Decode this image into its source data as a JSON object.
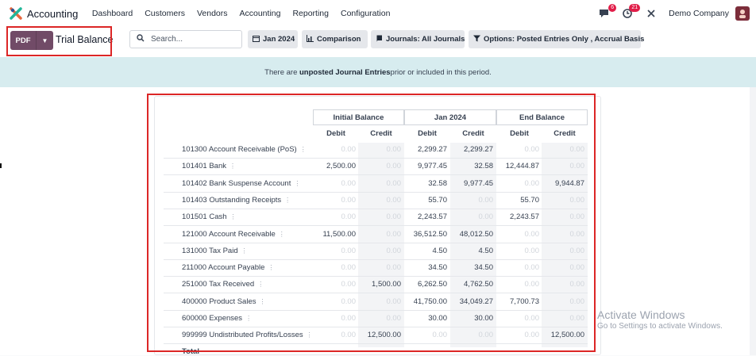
{
  "topbar": {
    "app_name": "Accounting",
    "menu": [
      "Dashboard",
      "Customers",
      "Vendors",
      "Accounting",
      "Reporting",
      "Configuration"
    ],
    "messages_count": "6",
    "activities_count": "21",
    "company": "Demo Company",
    "icons": [
      "odoo-logo-icon",
      "chat-icon",
      "clock-icon",
      "tools-icon",
      "avatar"
    ]
  },
  "control": {
    "pdf_label": "PDF",
    "page_title": "Trial Balance",
    "search_placeholder": "Search...",
    "filters": {
      "date": "Jan 2024",
      "comparison": "Comparison",
      "journals": "Journals: All Journals",
      "options": "Options: Posted Entries Only , Accrual Basis"
    }
  },
  "banner": {
    "prefix": "There are ",
    "bold": "unposted Journal Entries",
    "suffix": " prior or included in this period."
  },
  "report": {
    "groups": [
      "Initial Balance",
      "Jan 2024",
      "End Balance"
    ],
    "subheaders": [
      "Debit",
      "Credit",
      "Debit",
      "Credit",
      "Debit",
      "Credit"
    ],
    "rows": [
      {
        "account": "101300 Account Receivable (PoS)",
        "values": [
          "0.00",
          "0.00",
          "2,299.27",
          "2,299.27",
          "0.00",
          "0.00"
        ]
      },
      {
        "account": "101401 Bank",
        "values": [
          "2,500.00",
          "0.00",
          "9,977.45",
          "32.58",
          "12,444.87",
          "0.00"
        ]
      },
      {
        "account": "101402 Bank Suspense Account",
        "values": [
          "0.00",
          "0.00",
          "32.58",
          "9,977.45",
          "0.00",
          "9,944.87"
        ]
      },
      {
        "account": "101403 Outstanding Receipts",
        "values": [
          "0.00",
          "0.00",
          "55.70",
          "0.00",
          "55.70",
          "0.00"
        ]
      },
      {
        "account": "101501 Cash",
        "values": [
          "0.00",
          "0.00",
          "2,243.57",
          "0.00",
          "2,243.57",
          "0.00"
        ]
      },
      {
        "account": "121000 Account Receivable",
        "values": [
          "11,500.00",
          "0.00",
          "36,512.50",
          "48,012.50",
          "0.00",
          "0.00"
        ]
      },
      {
        "account": "131000 Tax Paid",
        "values": [
          "0.00",
          "0.00",
          "4.50",
          "4.50",
          "0.00",
          "0.00"
        ]
      },
      {
        "account": "211000 Account Payable",
        "values": [
          "0.00",
          "0.00",
          "34.50",
          "34.50",
          "0.00",
          "0.00"
        ]
      },
      {
        "account": "251000 Tax Received",
        "values": [
          "0.00",
          "1,500.00",
          "6,262.50",
          "4,762.50",
          "0.00",
          "0.00"
        ]
      },
      {
        "account": "400000 Product Sales",
        "values": [
          "0.00",
          "0.00",
          "41,750.00",
          "34,049.27",
          "7,700.73",
          "0.00"
        ]
      },
      {
        "account": "600000 Expenses",
        "values": [
          "0.00",
          "0.00",
          "30.00",
          "30.00",
          "0.00",
          "0.00"
        ]
      },
      {
        "account": "999999 Undistributed Profits/Losses",
        "values": [
          "0.00",
          "12,500.00",
          "0.00",
          "0.00",
          "0.00",
          "12,500.00"
        ]
      }
    ],
    "total_label": "Total"
  },
  "watermark": {
    "line1": "Activate Windows",
    "line2": "Go to Settings to activate Windows."
  },
  "colors": {
    "brand": "#714b67",
    "banner_bg": "#d7ecef",
    "highlight": "#dc2626",
    "badge": "#e11d48"
  }
}
